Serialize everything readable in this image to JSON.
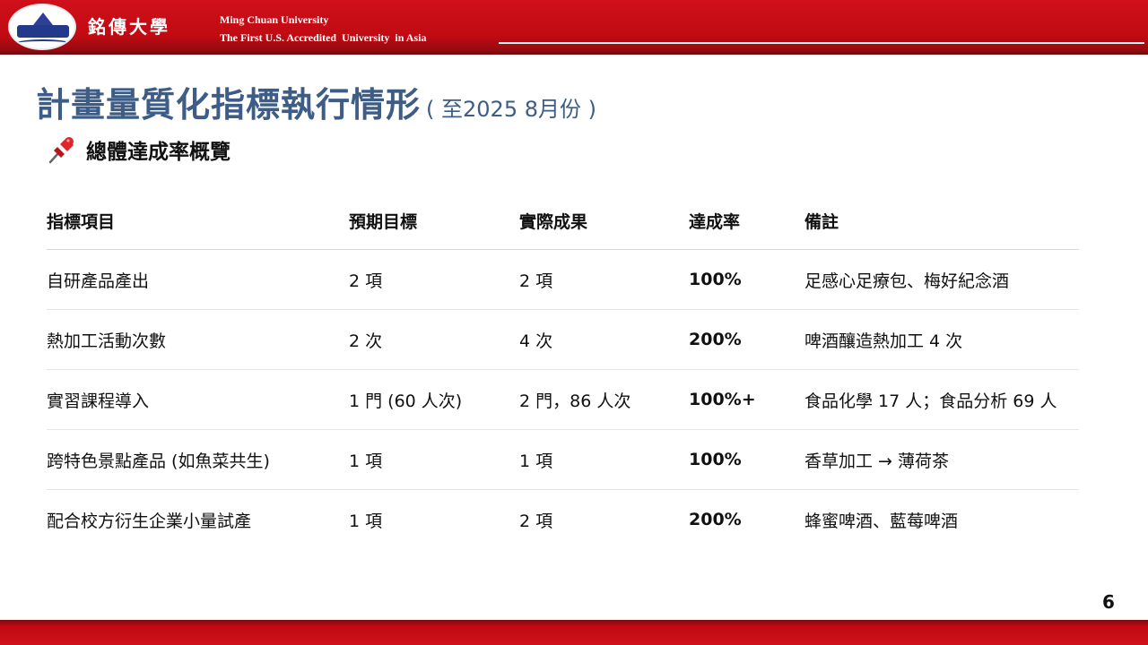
{
  "header": {
    "logo_name": "銘傳大學",
    "univ_en_line1": "Ming Chuan University",
    "univ_en_line2": "The First U.S. Accredited  University  in Asia"
  },
  "title": "計畫量質化指標執行情形",
  "title_suffix": "( 至2025 8月份 )",
  "section": {
    "icon": "pushpin-icon",
    "title": "總體達成率概覽"
  },
  "table": {
    "headers": [
      "指標項目",
      "預期目標",
      "實際成果",
      "達成率",
      "備註"
    ],
    "rows": [
      [
        "自研產品產出",
        "2 項",
        "2 項",
        "100%",
        "足感心足療包、梅好紀念酒"
      ],
      [
        "熱加工活動次數",
        "2 次",
        "4 次",
        "200%",
        "啤酒釀造熱加工 4 次"
      ],
      [
        "實習課程導入",
        "1 門 (60 人次)",
        "2 門，86 人次",
        "100%+",
        "食品化學 17 人；食品分析 69 人"
      ],
      [
        "跨特色景點產品 (如魚菜共生)",
        "1 項",
        "1 項",
        "100%",
        "香草加工 → 薄荷茶"
      ],
      [
        "配合校方衍生企業小量試產",
        "1 項",
        "2 項",
        "200%",
        "蜂蜜啤酒、藍莓啤酒"
      ]
    ]
  },
  "page_number": "6",
  "colors": {
    "brand_red": "#c00a12",
    "title_blue": "#3d5c86"
  }
}
